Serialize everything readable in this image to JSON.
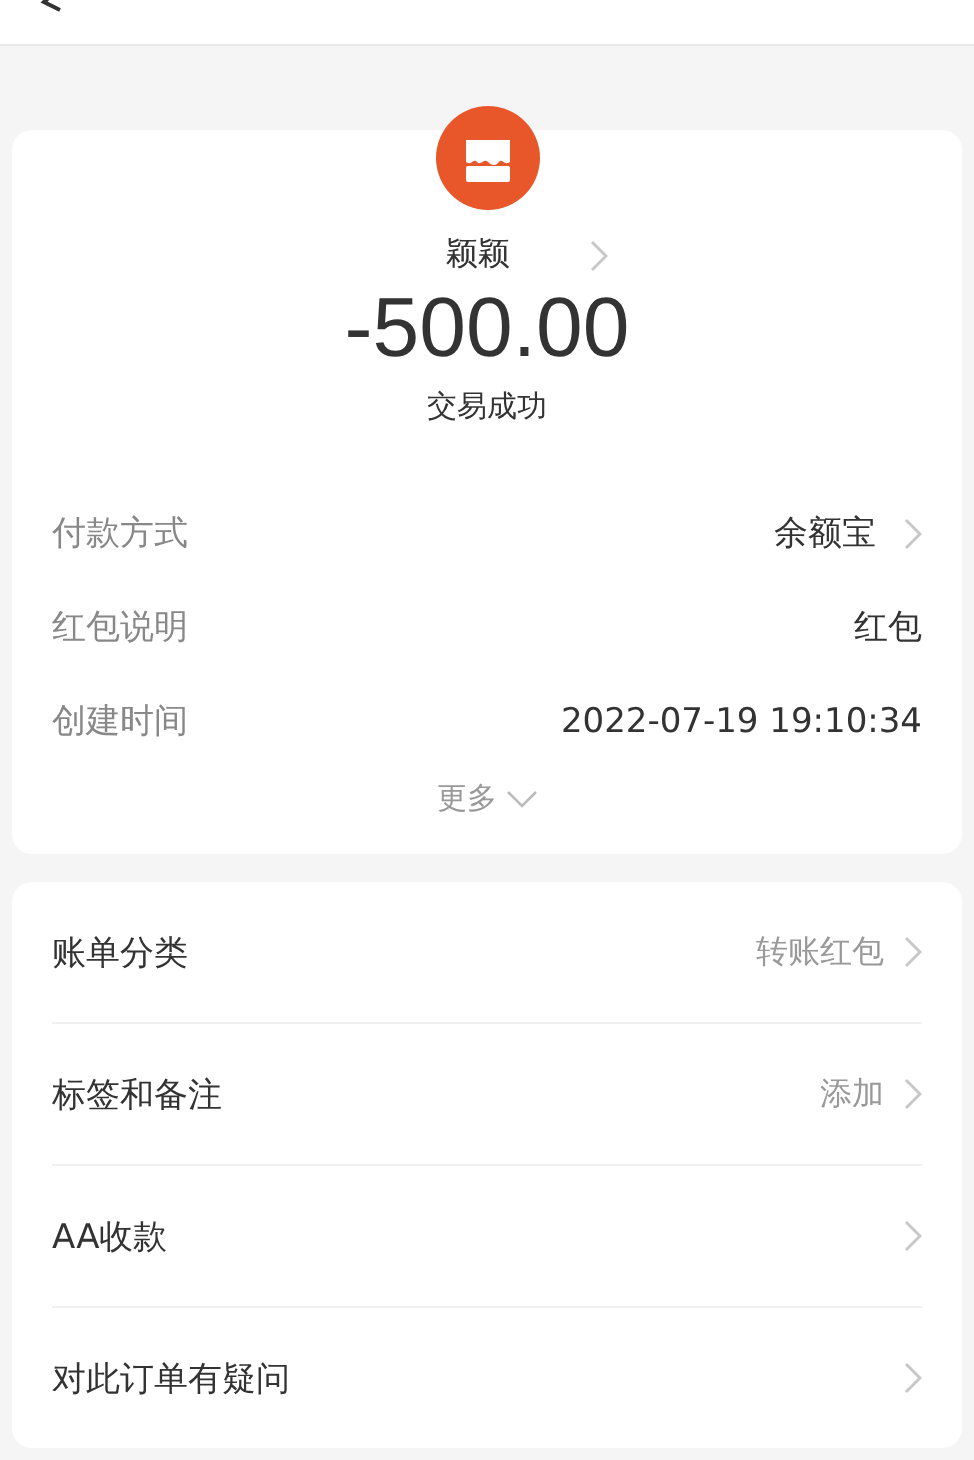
{
  "merchant": {
    "name": "颖颖",
    "amount": "-500.00",
    "status": "交易成功"
  },
  "details": [
    {
      "label": "付款方式",
      "value": "余额宝",
      "has_arrow": true
    },
    {
      "label": "红包说明",
      "value": "红包",
      "has_arrow": false
    },
    {
      "label": "创建时间",
      "value": "2022-07-19 19:10:34",
      "has_arrow": false
    }
  ],
  "more": "更多",
  "actions": [
    {
      "label": "账单分类",
      "value": "转账红包"
    },
    {
      "label": "标签和备注",
      "value": "添加"
    },
    {
      "label": "AA收款"
    },
    {
      "label": "对此订单有疑问"
    }
  ]
}
